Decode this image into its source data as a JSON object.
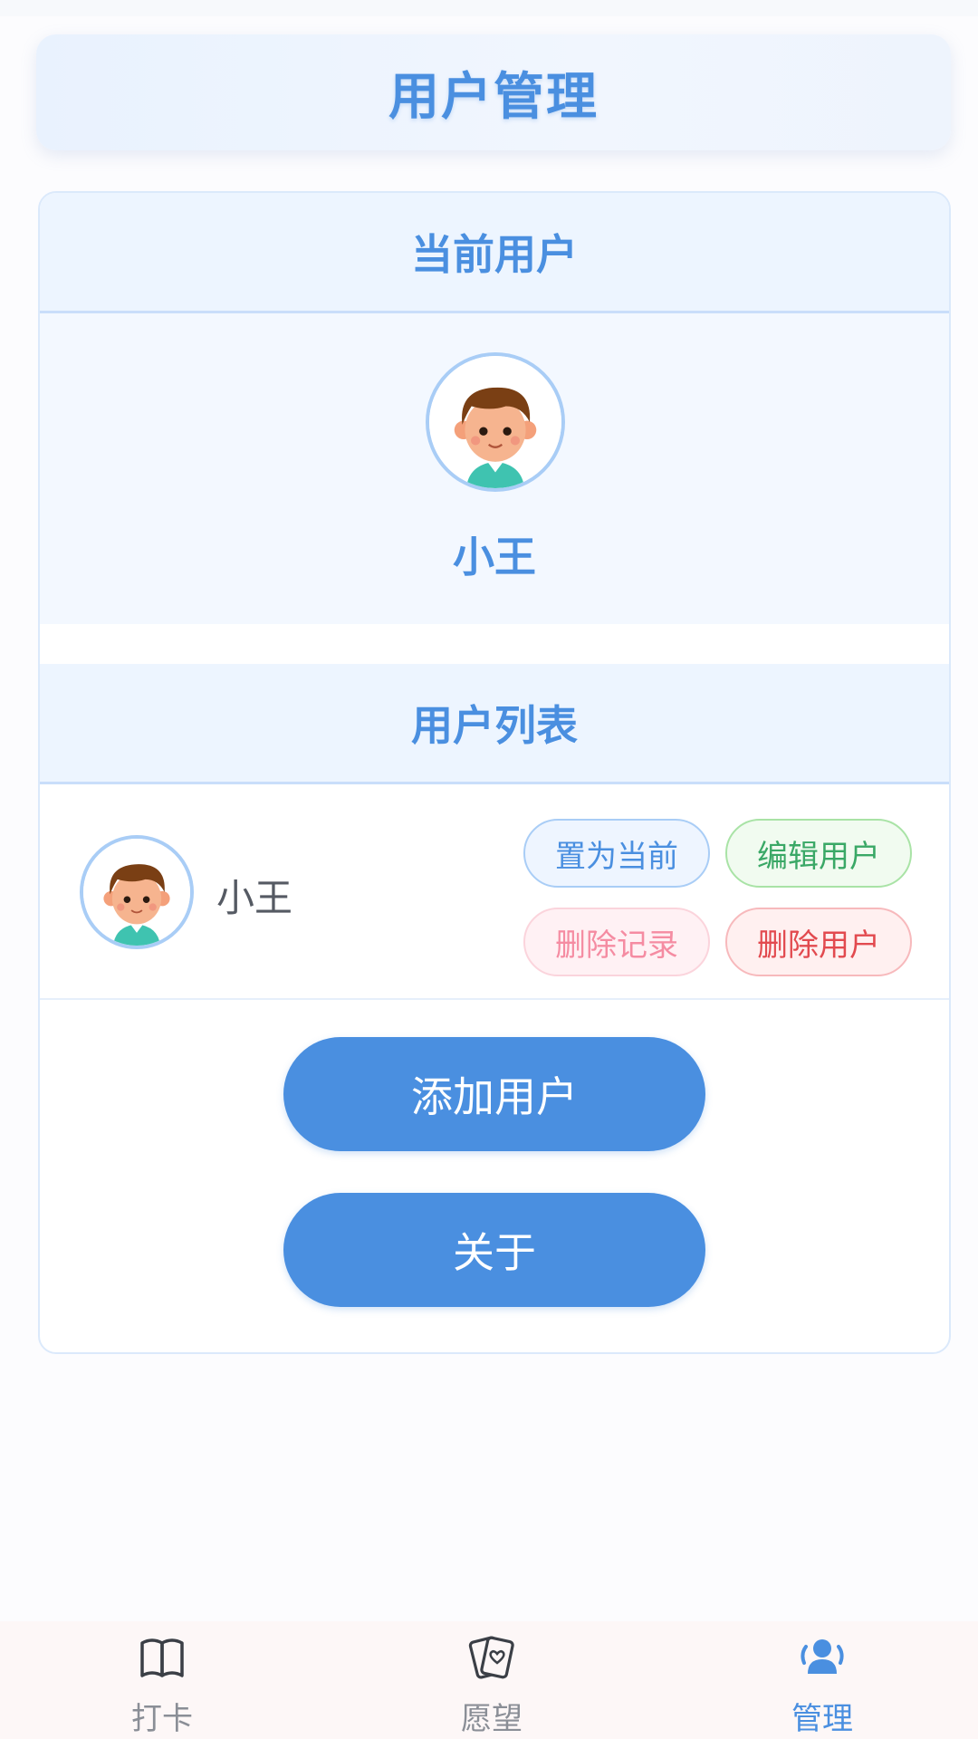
{
  "header": {
    "title": "用户管理"
  },
  "current_user": {
    "section_title": "当前用户",
    "name": "小王"
  },
  "user_list": {
    "section_title": "用户列表",
    "users": [
      {
        "name": "小王",
        "actions": {
          "set_current": "置为当前",
          "edit": "编辑用户",
          "delete_records": "删除记录",
          "delete_user": "删除用户"
        }
      }
    ]
  },
  "buttons": {
    "add_user": "添加用户",
    "about": "关于"
  },
  "tabbar": {
    "items": [
      {
        "label": "打卡",
        "icon": "open-book-icon",
        "active": false
      },
      {
        "label": "愿望",
        "icon": "wish-cards-icon",
        "active": false
      },
      {
        "label": "管理",
        "icon": "users-icon",
        "active": true
      }
    ]
  },
  "colors": {
    "primary": "#4a8fe0",
    "edit_green": "#3aa866",
    "delete_pink": "#f58ca2",
    "delete_red": "#e24a4f"
  }
}
